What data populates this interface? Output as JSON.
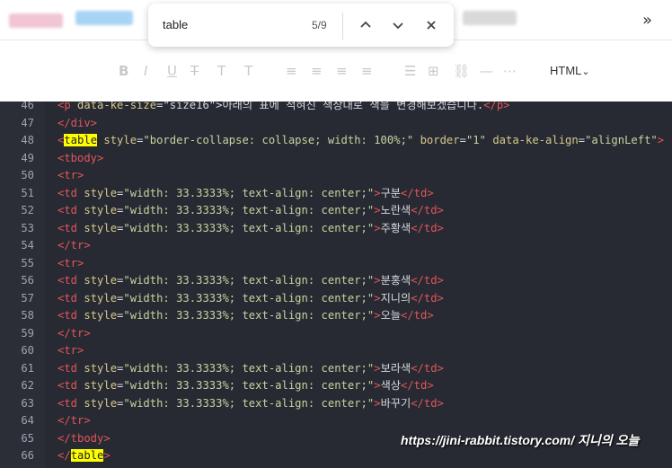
{
  "find": {
    "query": "table",
    "count": "5/9",
    "prev_icon": "chevron-up-icon",
    "next_icon": "chevron-down-icon",
    "close_icon": "close-icon"
  },
  "toolbar": {
    "mode_label": "HTML",
    "mode_chevron": "⌄"
  },
  "lines": [
    {
      "n": "46",
      "parts": [
        [
          "tag",
          "<p "
        ],
        [
          "attr",
          "data-ke-size"
        ],
        [
          "txt",
          "=\"size16\">"
        ],
        [
          "txt",
          "아래의 표에 적혀진 색상대로 색을 변경해보겠습니다."
        ],
        [
          "tag",
          "</p>"
        ]
      ]
    },
    {
      "n": "47",
      "parts": [
        [
          "tag",
          "</div>"
        ]
      ]
    },
    {
      "n": "48",
      "parts": [
        [
          "tag",
          "<"
        ],
        [
          "hl",
          "table"
        ],
        [
          "attr",
          " style"
        ],
        [
          "txt",
          "="
        ],
        [
          "str",
          "\"border-collapse: collapse; width: 100%;\""
        ],
        [
          "attr",
          " border"
        ],
        [
          "txt",
          "="
        ],
        [
          "str",
          "\"1\""
        ],
        [
          "attr",
          " data-ke-align"
        ],
        [
          "txt",
          "="
        ],
        [
          "str",
          "\"alignLeft\""
        ],
        [
          "tag",
          ">"
        ]
      ]
    },
    {
      "n": "49",
      "parts": [
        [
          "tag",
          "<tbody>"
        ]
      ]
    },
    {
      "n": "50",
      "parts": [
        [
          "tag",
          "<tr>"
        ]
      ]
    },
    {
      "n": "51",
      "parts": [
        [
          "tag",
          "<td "
        ],
        [
          "attr",
          "style"
        ],
        [
          "txt",
          "="
        ],
        [
          "str",
          "\"width: 33.3333%; text-align: center;\""
        ],
        [
          "tag",
          ">"
        ],
        [
          "txt",
          "구분"
        ],
        [
          "tag",
          "</td>"
        ]
      ]
    },
    {
      "n": "52",
      "parts": [
        [
          "tag",
          "<td "
        ],
        [
          "attr",
          "style"
        ],
        [
          "txt",
          "="
        ],
        [
          "str",
          "\"width: 33.3333%; text-align: center;\""
        ],
        [
          "tag",
          ">"
        ],
        [
          "txt",
          "노란색"
        ],
        [
          "tag",
          "</td>"
        ]
      ]
    },
    {
      "n": "53",
      "parts": [
        [
          "tag",
          "<td "
        ],
        [
          "attr",
          "style"
        ],
        [
          "txt",
          "="
        ],
        [
          "str",
          "\"width: 33.3333%; text-align: center;\""
        ],
        [
          "tag",
          ">"
        ],
        [
          "txt",
          "주황색"
        ],
        [
          "tag",
          "</td>"
        ]
      ]
    },
    {
      "n": "54",
      "parts": [
        [
          "tag",
          "</tr>"
        ]
      ]
    },
    {
      "n": "55",
      "parts": [
        [
          "tag",
          "<tr>"
        ]
      ]
    },
    {
      "n": "56",
      "parts": [
        [
          "tag",
          "<td "
        ],
        [
          "attr",
          "style"
        ],
        [
          "txt",
          "="
        ],
        [
          "str",
          "\"width: 33.3333%; text-align: center;\""
        ],
        [
          "tag",
          ">"
        ],
        [
          "txt",
          "분홍색"
        ],
        [
          "tag",
          "</td>"
        ]
      ]
    },
    {
      "n": "57",
      "parts": [
        [
          "tag",
          "<td "
        ],
        [
          "attr",
          "style"
        ],
        [
          "txt",
          "="
        ],
        [
          "str",
          "\"width: 33.3333%; text-align: center;\""
        ],
        [
          "tag",
          ">"
        ],
        [
          "txt",
          "지니의"
        ],
        [
          "tag",
          "</td>"
        ]
      ]
    },
    {
      "n": "58",
      "parts": [
        [
          "tag",
          "<td "
        ],
        [
          "attr",
          "style"
        ],
        [
          "txt",
          "="
        ],
        [
          "str",
          "\"width: 33.3333%; text-align: center;\""
        ],
        [
          "tag",
          ">"
        ],
        [
          "txt",
          "오늘"
        ],
        [
          "tag",
          "</td>"
        ]
      ]
    },
    {
      "n": "59",
      "parts": [
        [
          "tag",
          "</tr>"
        ]
      ]
    },
    {
      "n": "60",
      "parts": [
        [
          "tag",
          "<tr>"
        ]
      ]
    },
    {
      "n": "61",
      "parts": [
        [
          "tag",
          "<td "
        ],
        [
          "attr",
          "style"
        ],
        [
          "txt",
          "="
        ],
        [
          "str",
          "\"width: 33.3333%; text-align: center;\""
        ],
        [
          "tag",
          ">"
        ],
        [
          "txt",
          "보라색"
        ],
        [
          "tag",
          "</td>"
        ]
      ]
    },
    {
      "n": "62",
      "parts": [
        [
          "tag",
          "<td "
        ],
        [
          "attr",
          "style"
        ],
        [
          "txt",
          "="
        ],
        [
          "str",
          "\"width: 33.3333%; text-align: center;\""
        ],
        [
          "tag",
          ">"
        ],
        [
          "txt",
          "색상"
        ],
        [
          "tag",
          "</td>"
        ]
      ]
    },
    {
      "n": "63",
      "parts": [
        [
          "tag",
          "<td "
        ],
        [
          "attr",
          "style"
        ],
        [
          "txt",
          "="
        ],
        [
          "str",
          "\"width: 33.3333%; text-align: center;\""
        ],
        [
          "tag",
          ">"
        ],
        [
          "txt",
          "바꾸기"
        ],
        [
          "tag",
          "</td>"
        ]
      ]
    },
    {
      "n": "64",
      "parts": [
        [
          "tag",
          "</tr>"
        ]
      ]
    },
    {
      "n": "65",
      "parts": [
        [
          "tag",
          "</tbody>"
        ]
      ]
    },
    {
      "n": "66",
      "parts": [
        [
          "tag",
          "</"
        ],
        [
          "hl",
          "table"
        ],
        [
          "tag",
          ">"
        ]
      ]
    }
  ],
  "watermark": "https://jini-rabbit.tistory.com/ 지니의 오늘",
  "colors": {
    "editor_bg": "#272a32",
    "tag": "#e0565b",
    "highlight": "#ffff00"
  }
}
